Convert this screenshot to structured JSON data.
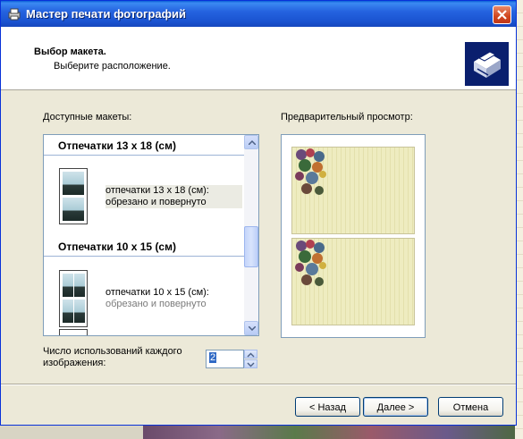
{
  "window": {
    "title": "Мастер печати фотографий"
  },
  "header": {
    "title": "Выбор макета.",
    "subtitle": "Выберите расположение."
  },
  "layouts": {
    "label": "Доступные макеты:",
    "groups": [
      {
        "title": "Отпечатки 13 х 18 (см)",
        "items": [
          {
            "line1": "отпечатки 13 х 18 (см):",
            "line2": "обрезано и повернуто"
          }
        ]
      },
      {
        "title": "Отпечатки 10 х 15 (см)",
        "items": [
          {
            "line1": "отпечатки 10 х 15 (см):",
            "line2": "обрезано и повернуто"
          }
        ]
      }
    ]
  },
  "preview": {
    "label": "Предварительный просмотр:"
  },
  "usage": {
    "label_line1": "Число использований каждого",
    "label_line2": "изображения:",
    "value": "2"
  },
  "buttons": {
    "back": "< Назад",
    "next": "Далее >",
    "cancel": "Отмена"
  }
}
